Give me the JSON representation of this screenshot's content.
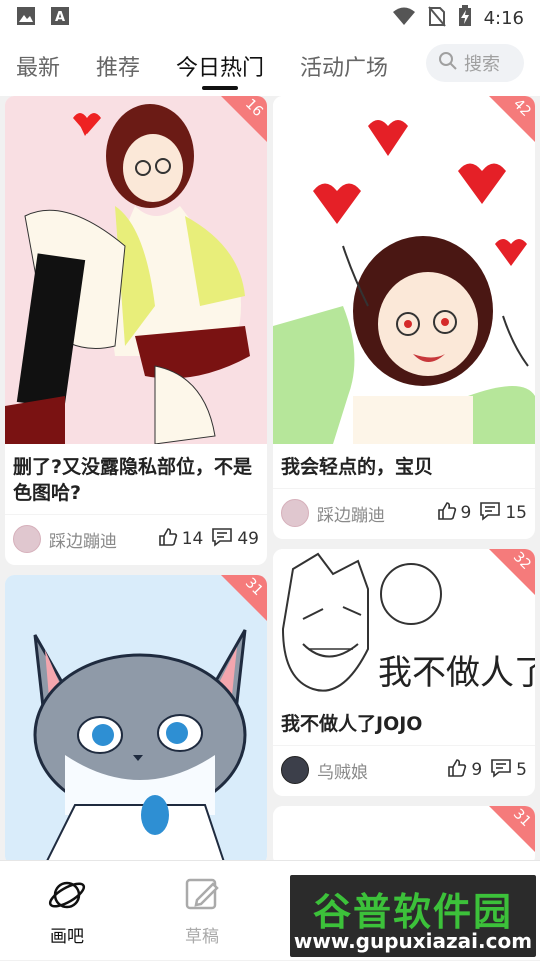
{
  "status_bar": {
    "time": "4:16",
    "icons": [
      "image-icon",
      "text-a-icon",
      "wifi-icon",
      "no-sim-icon",
      "battery-charging-icon"
    ]
  },
  "tabs": [
    {
      "label": "最新"
    },
    {
      "label": "推荐"
    },
    {
      "label": "今日热门",
      "active": true
    },
    {
      "label": "活动广场"
    }
  ],
  "search": {
    "placeholder": "搜索"
  },
  "posts": [
    {
      "title": "删了?又没露隐私部位，不是色图哈?",
      "author": "踩边蹦迪",
      "likes": "14",
      "comments": "49",
      "rank": "16",
      "image": "manga-girl-pink-background"
    },
    {
      "title": "我会轻点的，宝贝",
      "author": "踩边蹦迪",
      "likes": "9",
      "comments": "15",
      "rank": "42",
      "image": "manga-girl-hearts"
    },
    {
      "title": "",
      "author": "",
      "likes": "",
      "comments": "",
      "rank": "31",
      "image": "gray-cat-drawing"
    },
    {
      "title": "我不做人了JOJO",
      "author": "乌贼娘",
      "likes": "9",
      "comments": "5",
      "rank": "32",
      "image": "sketch-face-text",
      "image_text": "我不做人了"
    },
    {
      "title": "",
      "author": "",
      "likes": "",
      "comments": "",
      "rank": "31",
      "image": "blank"
    }
  ],
  "bottom_nav": [
    {
      "label": "画吧",
      "icon": "planet-icon",
      "active": true
    },
    {
      "label": "草稿",
      "icon": "edit-icon"
    }
  ],
  "watermark": {
    "title": "谷普软件园",
    "url": "www.gupuxiazai.com"
  },
  "colors": {
    "ribbon": "#f57b7b",
    "accent_text": "#111111",
    "muted_text": "#8a8a8a",
    "watermark_green": "#3cc13a"
  }
}
